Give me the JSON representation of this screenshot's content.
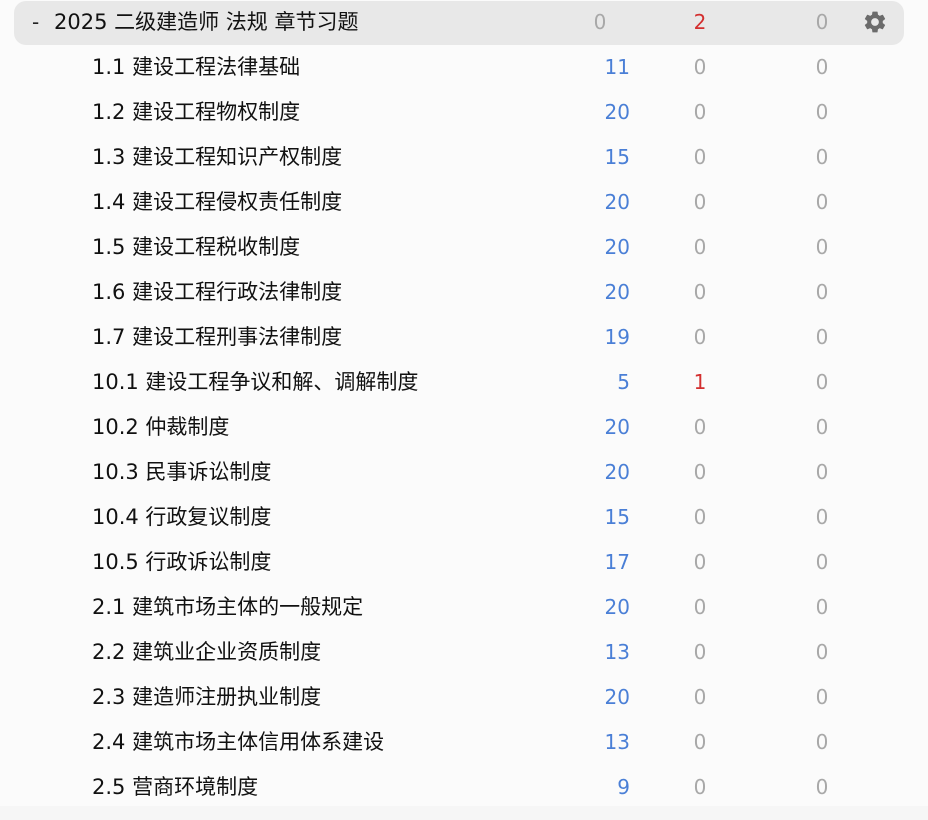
{
  "colors": {
    "new": "#4a7fd6",
    "learn": "#d32f2f",
    "due": "#a8a8a8",
    "zero": "#a8a8a8"
  },
  "deck": {
    "collapse_symbol": "-",
    "name": "2025 二级建造师 法规 章节习题",
    "new": "0",
    "learn": "2",
    "due": "0",
    "options_icon": "gear-icon"
  },
  "subdecks": [
    {
      "name": "1.1 建设工程法律基础",
      "new": "11",
      "learn": "0",
      "due": "0"
    },
    {
      "name": "1.2 建设工程物权制度",
      "new": "20",
      "learn": "0",
      "due": "0"
    },
    {
      "name": "1.3 建设工程知识产权制度",
      "new": "15",
      "learn": "0",
      "due": "0"
    },
    {
      "name": "1.4 建设工程侵权责任制度",
      "new": "20",
      "learn": "0",
      "due": "0"
    },
    {
      "name": "1.5 建设工程税收制度",
      "new": "20",
      "learn": "0",
      "due": "0"
    },
    {
      "name": "1.6 建设工程行政法律制度",
      "new": "20",
      "learn": "0",
      "due": "0"
    },
    {
      "name": "1.7 建设工程刑事法律制度",
      "new": "19",
      "learn": "0",
      "due": "0"
    },
    {
      "name": "10.1 建设工程争议和解、调解制度",
      "new": "5",
      "learn": "1",
      "due": "0"
    },
    {
      "name": "10.2 仲裁制度",
      "new": "20",
      "learn": "0",
      "due": "0"
    },
    {
      "name": "10.3 民事诉讼制度",
      "new": "20",
      "learn": "0",
      "due": "0"
    },
    {
      "name": "10.4 行政复议制度",
      "new": "15",
      "learn": "0",
      "due": "0"
    },
    {
      "name": "10.5 行政诉讼制度",
      "new": "17",
      "learn": "0",
      "due": "0"
    },
    {
      "name": "2.1 建筑市场主体的一般规定",
      "new": "20",
      "learn": "0",
      "due": "0"
    },
    {
      "name": "2.2 建筑业企业资质制度",
      "new": "13",
      "learn": "0",
      "due": "0"
    },
    {
      "name": "2.3 建造师注册执业制度",
      "new": "20",
      "learn": "0",
      "due": "0"
    },
    {
      "name": "2.4 建筑市场主体信用体系建设",
      "new": "13",
      "learn": "0",
      "due": "0"
    },
    {
      "name": "2.5 营商环境制度",
      "new": "9",
      "learn": "0",
      "due": "0"
    }
  ]
}
